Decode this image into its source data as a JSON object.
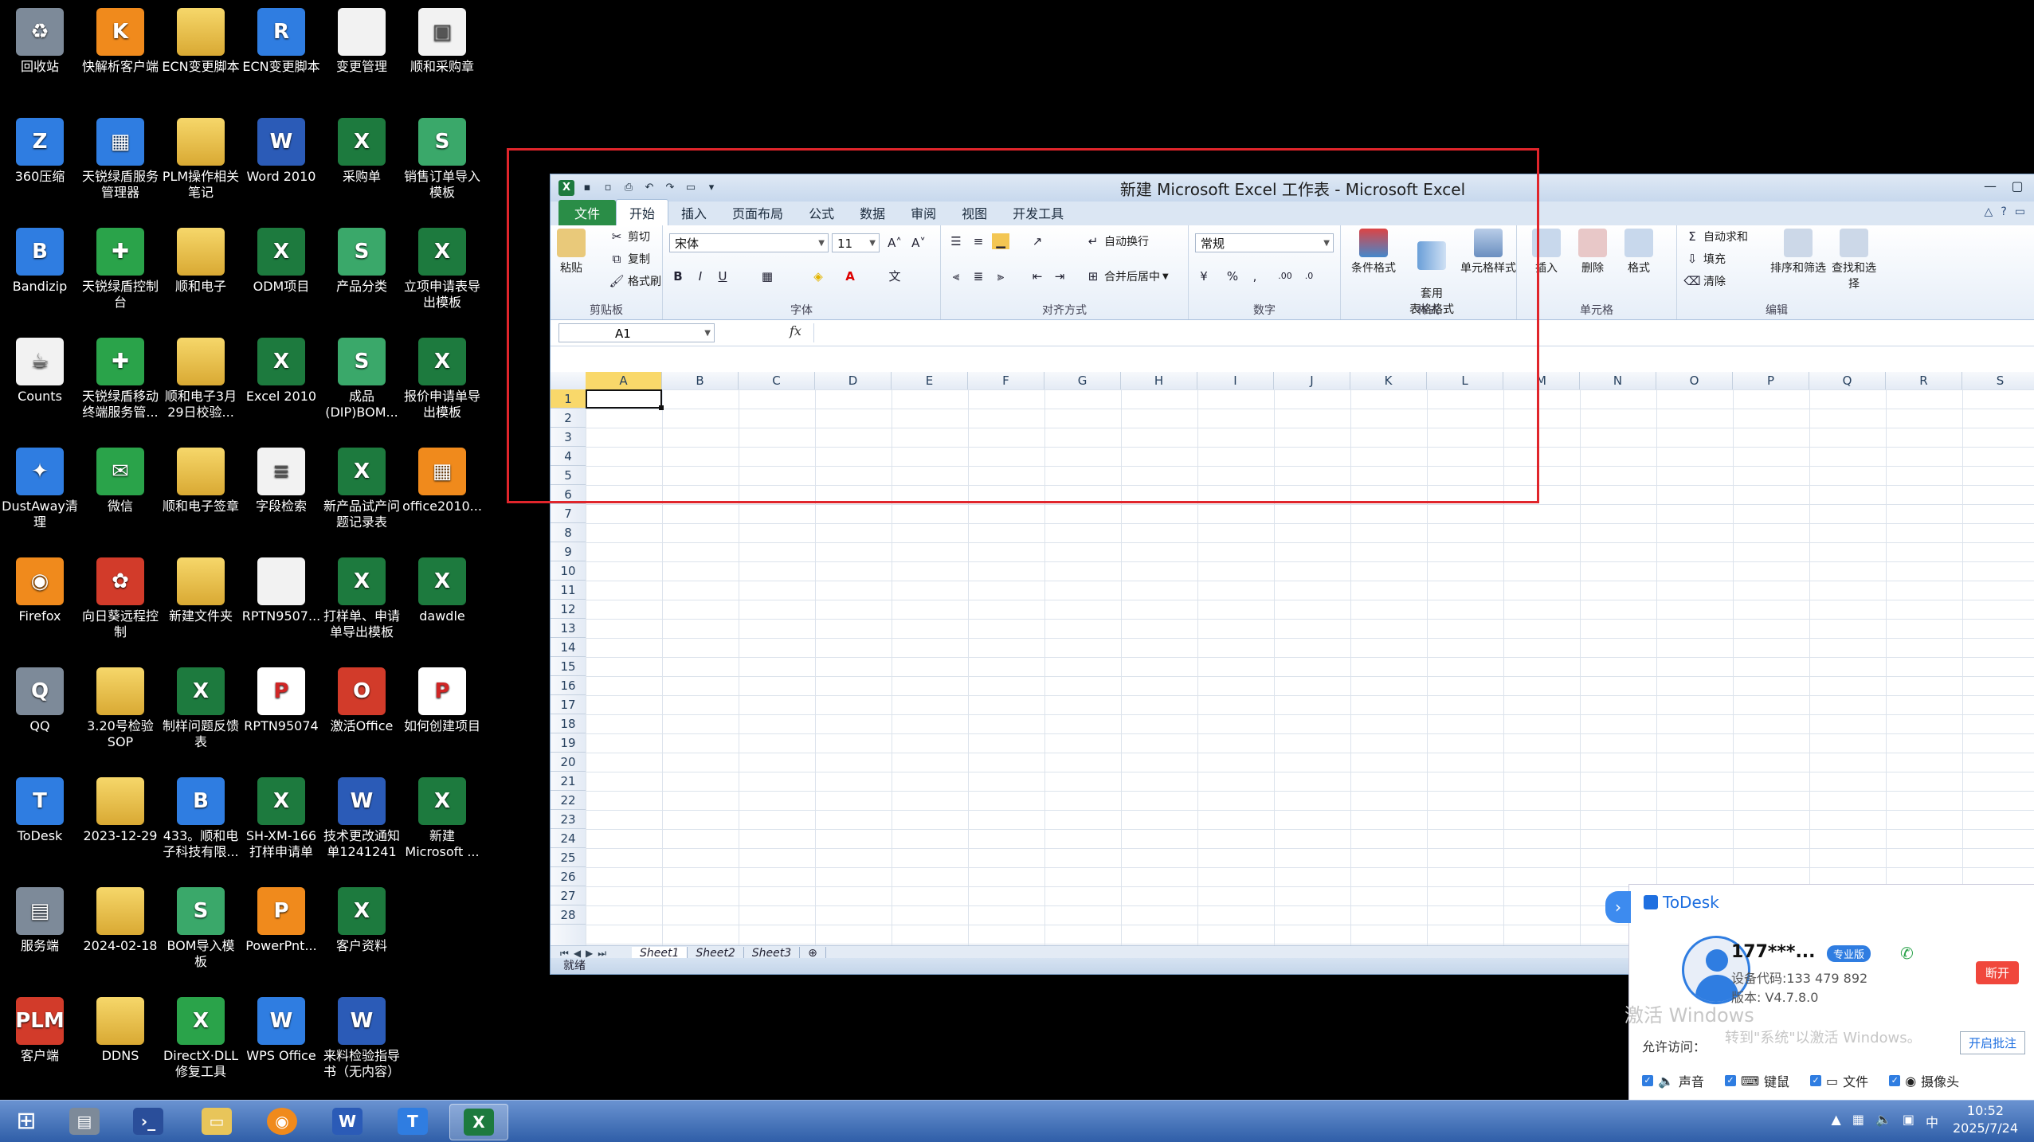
{
  "desktop": {
    "col1": [
      {
        "label": "回收站",
        "icon": "recycle-bin-icon",
        "glyph": "♻"
      },
      {
        "label": "360压缩",
        "icon": "archive-icon",
        "glyph": "Z"
      },
      {
        "label": "Bandizip",
        "icon": "bandizip-icon",
        "glyph": "B"
      },
      {
        "label": "Counts",
        "icon": "java-icon",
        "glyph": "☕"
      },
      {
        "label": "DustAway清理",
        "icon": "broom-icon",
        "glyph": "✦"
      },
      {
        "label": "Firefox",
        "icon": "firefox-icon",
        "glyph": "◉"
      },
      {
        "label": "QQ",
        "icon": "qq-penguin-icon",
        "glyph": "Q"
      },
      {
        "label": "ToDesk",
        "icon": "todesk-icon",
        "glyph": "T"
      },
      {
        "label": "服务端",
        "icon": "server-icon",
        "glyph": "▤"
      },
      {
        "label": "客户端",
        "icon": "plm-icon",
        "glyph": "PLM"
      }
    ],
    "col2": [
      {
        "label": "快解析客户端",
        "icon": "kuaijiexi-icon",
        "glyph": "K"
      },
      {
        "label": "天锐绿盾服务管理器",
        "icon": "service-manager-icon",
        "glyph": "▦"
      },
      {
        "label": "天锐绿盾控制台",
        "icon": "shield-icon",
        "glyph": "✚"
      },
      {
        "label": "天锐绿盾移动终端服务管...",
        "icon": "shield-icon",
        "glyph": "✚"
      },
      {
        "label": "微信",
        "icon": "wechat-icon",
        "glyph": "✉"
      },
      {
        "label": "向日葵远程控制",
        "icon": "sunflower-icon",
        "glyph": "✿"
      },
      {
        "label": "3.20号检验SOP",
        "icon": "folder-icon",
        "glyph": ""
      },
      {
        "label": "2023-12-29",
        "icon": "folder-icon",
        "glyph": ""
      },
      {
        "label": "2024-02-18",
        "icon": "folder-icon",
        "glyph": ""
      },
      {
        "label": "DDNS",
        "icon": "folder-icon",
        "glyph": ""
      }
    ],
    "col3": [
      {
        "label": "ECN变更脚本",
        "icon": "folder-icon",
        "glyph": ""
      },
      {
        "label": "PLM操作相关笔记",
        "icon": "folder-icon",
        "glyph": ""
      },
      {
        "label": "顺和电子",
        "icon": "folder-icon",
        "glyph": ""
      },
      {
        "label": "顺和电子3月29日校验...",
        "icon": "folder-icon",
        "glyph": ""
      },
      {
        "label": "顺和电子签章",
        "icon": "folder-icon",
        "glyph": ""
      },
      {
        "label": "新建文件夹",
        "icon": "folder-icon",
        "glyph": ""
      },
      {
        "label": "制样问题反馈表",
        "icon": "excel-file-icon",
        "glyph": "X"
      },
      {
        "label": "433。顺和电子科技有限...",
        "icon": "bandizip-icon",
        "glyph": "B"
      },
      {
        "label": "BOM导入模板",
        "icon": "wps-sheet-icon",
        "glyph": "S"
      },
      {
        "label": "DirectX·DLL修复工具",
        "icon": "directx-icon",
        "glyph": "X"
      }
    ],
    "col4": [
      {
        "label": "ECN变更脚本",
        "icon": "winrar-icon",
        "glyph": "R"
      },
      {
        "label": "Word 2010",
        "icon": "word-icon",
        "glyph": "W"
      },
      {
        "label": "ODM项目",
        "icon": "excel-file-icon",
        "glyph": "X"
      },
      {
        "label": "Excel 2010",
        "icon": "excel-icon",
        "glyph": "X"
      },
      {
        "label": "字段检索",
        "icon": "document-icon",
        "glyph": "≡"
      },
      {
        "label": "RPTN9507...",
        "icon": "blank-file-icon",
        "glyph": ""
      },
      {
        "label": "RPTN95074",
        "icon": "pdf-icon",
        "glyph": "P"
      },
      {
        "label": "SH-XM-166打样申请单",
        "icon": "excel-file-icon",
        "glyph": "X"
      },
      {
        "label": "PowerPnt...",
        "icon": "powerpoint-icon",
        "glyph": "P"
      },
      {
        "label": "WPS Office",
        "icon": "wps-icon",
        "glyph": "W"
      }
    ],
    "col5": [
      {
        "label": "变更管理",
        "icon": "blank-file-icon",
        "glyph": ""
      },
      {
        "label": "采购单",
        "icon": "excel-file-icon",
        "glyph": "X"
      },
      {
        "label": "产品分类",
        "icon": "wps-sheet-icon",
        "glyph": "S"
      },
      {
        "label": "成品(DIP)BOM...",
        "icon": "wps-sheet-icon",
        "glyph": "S"
      },
      {
        "label": "新产品试产问题记录表",
        "icon": "excel-file-icon",
        "glyph": "X"
      },
      {
        "label": "打样单、申请单导出模板",
        "icon": "excel-file-icon",
        "glyph": "X"
      },
      {
        "label": "激活Office",
        "icon": "office-icon",
        "glyph": "O"
      },
      {
        "label": "技术更改通知单1241241",
        "icon": "word-file-icon",
        "glyph": "W"
      },
      {
        "label": "客户资料",
        "icon": "excel-file-icon",
        "glyph": "X"
      },
      {
        "label": "来料检验指导书（无内容）",
        "icon": "word-file-icon",
        "glyph": "W"
      }
    ],
    "col6": [
      {
        "label": "顺和采购章",
        "icon": "image-file-icon",
        "glyph": "▣"
      },
      {
        "label": "销售订单导入模板",
        "icon": "wps-sheet-icon",
        "glyph": "S"
      },
      {
        "label": "立项申请表导出模板",
        "icon": "excel-file-icon",
        "glyph": "X"
      },
      {
        "label": "报价申请单导出模板",
        "icon": "excel-file-icon",
        "glyph": "X"
      },
      {
        "label": "office2010...",
        "icon": "office-installer-icon",
        "glyph": "▦"
      },
      {
        "label": "dawdle",
        "icon": "excel-file-icon",
        "glyph": "X"
      },
      {
        "label": "如何创建项目",
        "icon": "pdf-icon",
        "glyph": "P"
      },
      {
        "label": "新建 Microsoft ...",
        "icon": "excel-file-icon",
        "glyph": "X"
      }
    ]
  },
  "excel": {
    "title": "新建 Microsoft Excel 工作表 - Microsoft Excel",
    "tabs": [
      "文件",
      "开始",
      "插入",
      "页面布局",
      "公式",
      "数据",
      "审阅",
      "视图",
      "开发工具"
    ],
    "clipboard": {
      "paste": "粘贴",
      "cut": "剪切",
      "copy": "复制",
      "painter": "格式刷",
      "group": "剪贴板"
    },
    "font": {
      "name": "宋体",
      "size": "11",
      "group": "字体"
    },
    "alignment": {
      "wrap": "自动换行",
      "merge": "合并后居中",
      "group": "对齐方式"
    },
    "number": {
      "format": "常规",
      "group": "数字"
    },
    "styles": {
      "cond": "条件格式",
      "table": "套用\n表格格式",
      "cell": "单元格样式",
      "group": "样式"
    },
    "cells": {
      "insert": "插入",
      "delete": "删除",
      "format": "格式",
      "group": "单元格"
    },
    "editing": {
      "autosum": "自动求和",
      "fill": "填充",
      "clear": "清除",
      "sort": "排序和筛选",
      "find": "查找和选择",
      "group": "编辑"
    },
    "namebox": "A1",
    "fx": "fx",
    "columns": [
      "A",
      "B",
      "C",
      "D",
      "E",
      "F",
      "G",
      "H",
      "I",
      "J",
      "K",
      "L",
      "M",
      "N",
      "O",
      "P",
      "Q",
      "R",
      "S"
    ],
    "rows": [
      "1",
      "2",
      "3",
      "4",
      "5",
      "6",
      "7",
      "8",
      "9",
      "10",
      "11",
      "12",
      "13",
      "14",
      "15",
      "16",
      "17",
      "18",
      "19",
      "20",
      "21",
      "22",
      "23",
      "24",
      "25",
      "26",
      "27",
      "28"
    ],
    "sheets": [
      "Sheet1",
      "Sheet2",
      "Sheet3"
    ],
    "status": "就绪"
  },
  "todesk": {
    "brand": "ToDesk",
    "name": "177***...",
    "badge": "专业版",
    "device_code": "设备代码:133 479 892",
    "version": "版本: V4.7.8.0",
    "disconnect": "断开",
    "watermark": "激活 Windows",
    "watermark2": "转到\"系统\"以激活 Windows。",
    "allow": "允许访问：",
    "annotate": "开启批注",
    "perms": [
      "声音",
      "键鼠",
      "文件",
      "摄像头"
    ]
  },
  "taskbar": {
    "time": "10:52",
    "date": "2025/7/24",
    "ime": "中"
  },
  "colors": {
    "accent": "#2a8d47",
    "annotation": "#e0252b",
    "taskbar": "#2f5ea8"
  }
}
